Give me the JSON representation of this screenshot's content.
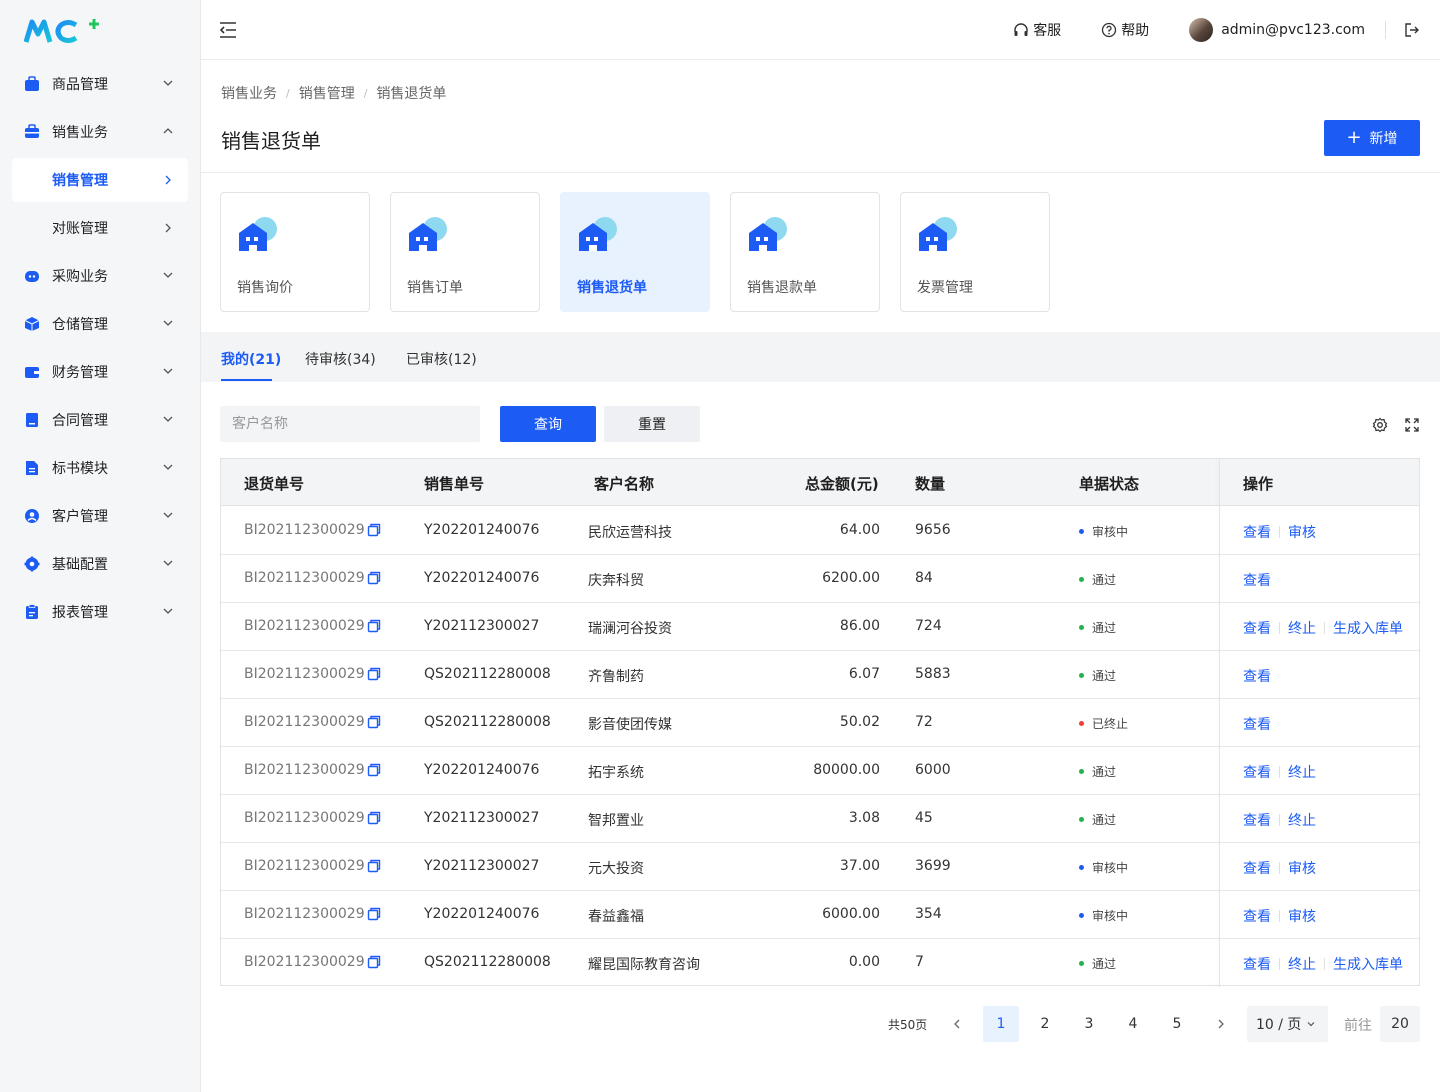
{
  "brand": {
    "logo_text": "MC",
    "logo_plus": "+"
  },
  "header": {
    "service_label": "客服",
    "help_label": "帮助",
    "user_email": "admin@pvc123.com"
  },
  "sidebar": {
    "items": [
      {
        "label": "商品管理",
        "icon": "goods-icon",
        "expanded": false
      },
      {
        "label": "销售业务",
        "icon": "sales-icon",
        "expanded": true
      },
      {
        "label": "采购业务",
        "icon": "purchase-icon",
        "expanded": false
      },
      {
        "label": "仓储管理",
        "icon": "warehouse-icon",
        "expanded": false
      },
      {
        "label": "财务管理",
        "icon": "finance-icon",
        "expanded": false
      },
      {
        "label": "合同管理",
        "icon": "contract-icon",
        "expanded": false
      },
      {
        "label": "标书模块",
        "icon": "tender-icon",
        "expanded": false
      },
      {
        "label": "客户管理",
        "icon": "customer-icon",
        "expanded": false
      },
      {
        "label": "基础配置",
        "icon": "settings-icon",
        "expanded": false
      },
      {
        "label": "报表管理",
        "icon": "report-icon",
        "expanded": false
      }
    ],
    "sub_items": [
      {
        "label": "销售管理",
        "active": true
      },
      {
        "label": "对账管理",
        "active": false
      }
    ]
  },
  "breadcrumb": [
    "销售业务",
    "销售管理",
    "销售退货单"
  ],
  "page": {
    "title": "销售退货单",
    "new_button": "新增"
  },
  "cards": [
    {
      "label": "销售询价",
      "active": false
    },
    {
      "label": "销售订单",
      "active": false
    },
    {
      "label": "销售退货单",
      "active": true
    },
    {
      "label": "销售退款单",
      "active": false
    },
    {
      "label": "发票管理",
      "active": false
    }
  ],
  "tabs": [
    {
      "label": "我的(21)",
      "active": true
    },
    {
      "label": "待审核(34)",
      "active": false
    },
    {
      "label": "已审核(12)",
      "active": false
    }
  ],
  "filter": {
    "placeholder": "客户名称",
    "query_label": "查询",
    "reset_label": "重置"
  },
  "table": {
    "headers": [
      "退货单号",
      "销售单号",
      "客户名称",
      "总金额(元)",
      "数量",
      "单据状态",
      "操作"
    ],
    "rows": [
      {
        "return_no": "BI202112300029",
        "sales_no": "Y202201240076",
        "customer": "民欣运营科技",
        "amount": "64.00",
        "qty": "9656",
        "status": "审核中",
        "status_color": "#1d5cf4",
        "ops": [
          "查看",
          "审核"
        ]
      },
      {
        "return_no": "BI202112300029",
        "sales_no": "Y202201240076",
        "customer": "庆奔科贸",
        "amount": "6200.00",
        "qty": "84",
        "status": "通过",
        "status_color": "#22b14c",
        "ops": [
          "查看"
        ]
      },
      {
        "return_no": "BI202112300029",
        "sales_no": "Y202112300027",
        "customer": "瑞澜河谷投资",
        "amount": "86.00",
        "qty": "724",
        "status": "通过",
        "status_color": "#22b14c",
        "ops": [
          "查看",
          "终止",
          "生成入库单"
        ]
      },
      {
        "return_no": "BI202112300029",
        "sales_no": "QS202112280008",
        "customer": "齐鲁制药",
        "amount": "6.07",
        "qty": "5883",
        "status": "通过",
        "status_color": "#22b14c",
        "ops": [
          "查看"
        ]
      },
      {
        "return_no": "BI202112300029",
        "sales_no": "QS202112280008",
        "customer": "影音使团传媒",
        "amount": "50.02",
        "qty": "72",
        "status": "已终止",
        "status_color": "#f03d3d",
        "ops": [
          "查看"
        ]
      },
      {
        "return_no": "BI202112300029",
        "sales_no": "Y202201240076",
        "customer": "拓宇系统",
        "amount": "80000.00",
        "qty": "6000",
        "status": "通过",
        "status_color": "#22b14c",
        "ops": [
          "查看",
          "终止"
        ]
      },
      {
        "return_no": "BI202112300029",
        "sales_no": "Y202112300027",
        "customer": "智邦置业",
        "amount": "3.08",
        "qty": "45",
        "status": "通过",
        "status_color": "#22b14c",
        "ops": [
          "查看",
          "终止"
        ]
      },
      {
        "return_no": "BI202112300029",
        "sales_no": "Y202112300027",
        "customer": "元大投资",
        "amount": "37.00",
        "qty": "3699",
        "status": "审核中",
        "status_color": "#1d5cf4",
        "ops": [
          "查看",
          "审核"
        ]
      },
      {
        "return_no": "BI202112300029",
        "sales_no": "Y202201240076",
        "customer": "春益鑫福",
        "amount": "6000.00",
        "qty": "354",
        "status": "审核中",
        "status_color": "#1d5cf4",
        "ops": [
          "查看",
          "审核"
        ]
      },
      {
        "return_no": "BI202112300029",
        "sales_no": "QS202112280008",
        "customer": "耀昆国际教育咨询",
        "amount": "0.00",
        "qty": "7",
        "status": "通过",
        "status_color": "#22b14c",
        "ops": [
          "查看",
          "终止",
          "生成入库单"
        ]
      }
    ]
  },
  "pagination": {
    "total_label": "共50页",
    "pages": [
      "1",
      "2",
      "3",
      "4",
      "5"
    ],
    "current": "1",
    "page_size": "10 / 页",
    "goto_label": "前往",
    "goto_value": "20"
  },
  "colors": {
    "primary": "#1d5cf4",
    "success": "#22b14c",
    "danger": "#f03d3d"
  }
}
